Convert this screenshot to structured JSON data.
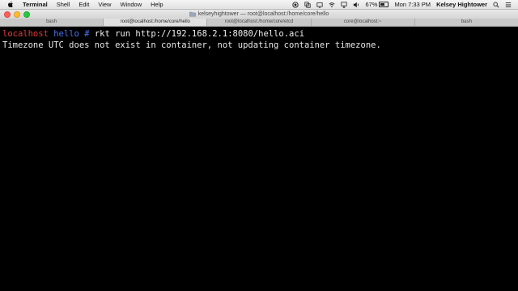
{
  "menubar": {
    "app_name": "Terminal",
    "menus": [
      "Shell",
      "Edit",
      "View",
      "Window",
      "Help"
    ],
    "battery_percent": "67%",
    "battery_level": 0.67,
    "datetime": "Mon 7:33 PM",
    "user": "Kelsey Hightower",
    "status_icons": [
      "record-icon",
      "copy-icon",
      "screen-icon",
      "wifi-icon",
      "airplay-icon",
      "volume-icon",
      "battery-icon",
      "search-icon",
      "list-icon"
    ]
  },
  "window": {
    "title": "kelseyhightower — root@localhost:/home/core/hello"
  },
  "tabs": [
    {
      "label": "bash",
      "active": false
    },
    {
      "label": "root@localhost:/home/core/hello",
      "active": true
    },
    {
      "label": "root@localhost:/home/core/etcd",
      "active": false
    },
    {
      "label": "core@localhost:~",
      "active": false
    },
    {
      "label": "bash",
      "active": false
    }
  ],
  "terminal": {
    "prompt_host": "localhost",
    "prompt_dir": "hello",
    "prompt_symbol": "#",
    "command": "rkt run http://192.168.2.1:8080/hello.aci",
    "output": "Timezone UTC does not exist in container, not updating container timezone."
  },
  "colors": {
    "prompt_host": "#e23a3a",
    "prompt_dir": "#4a74f0",
    "background": "#000000"
  }
}
